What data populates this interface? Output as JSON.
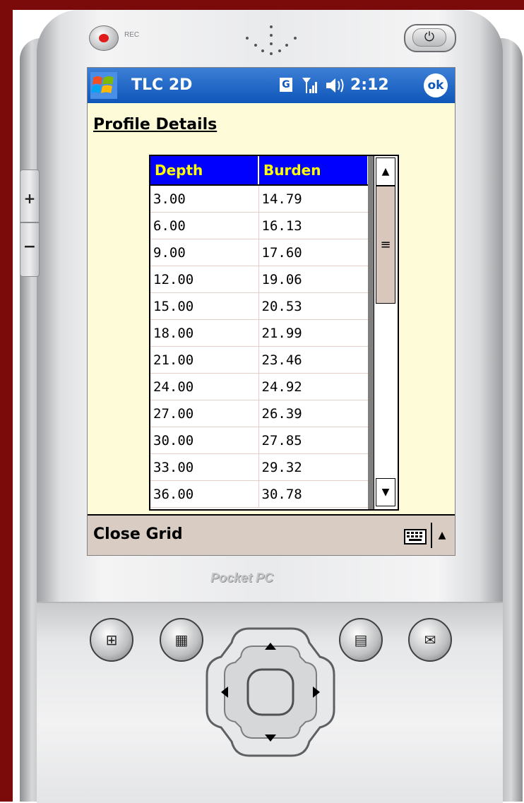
{
  "device": {
    "rec_label": "REC",
    "brand": "Pocket PC",
    "buttons": [
      "windows-start-icon",
      "calendar-icon",
      "contacts-icon",
      "inbox-icon"
    ],
    "side_buttons": {
      "plus": "+",
      "minus": "−"
    }
  },
  "titlebar": {
    "app_title": "TLC 2D",
    "g_indicator": "G",
    "time": "2:12",
    "ok_label": "ok"
  },
  "page": {
    "heading": "Profile Details"
  },
  "grid": {
    "columns": [
      "Depth",
      "Burden"
    ],
    "rows": [
      [
        "3.00",
        "14.79"
      ],
      [
        "6.00",
        "16.13"
      ],
      [
        "9.00",
        "17.60"
      ],
      [
        "12.00",
        "19.06"
      ],
      [
        "15.00",
        "20.53"
      ],
      [
        "18.00",
        "21.99"
      ],
      [
        "21.00",
        "23.46"
      ],
      [
        "24.00",
        "24.92"
      ],
      [
        "27.00",
        "26.39"
      ],
      [
        "30.00",
        "27.85"
      ],
      [
        "33.00",
        "29.32"
      ],
      [
        "36.00",
        "30.78"
      ]
    ],
    "header_bg": "#0000ff",
    "header_fg": "#ffff00"
  },
  "menubar": {
    "left_label": "Close Grid"
  },
  "colors": {
    "screen_bg": "#fefbd8",
    "titlebar": "#0f56b9",
    "menubar": "#d9ccc3",
    "frame": "#7b0a0a"
  }
}
